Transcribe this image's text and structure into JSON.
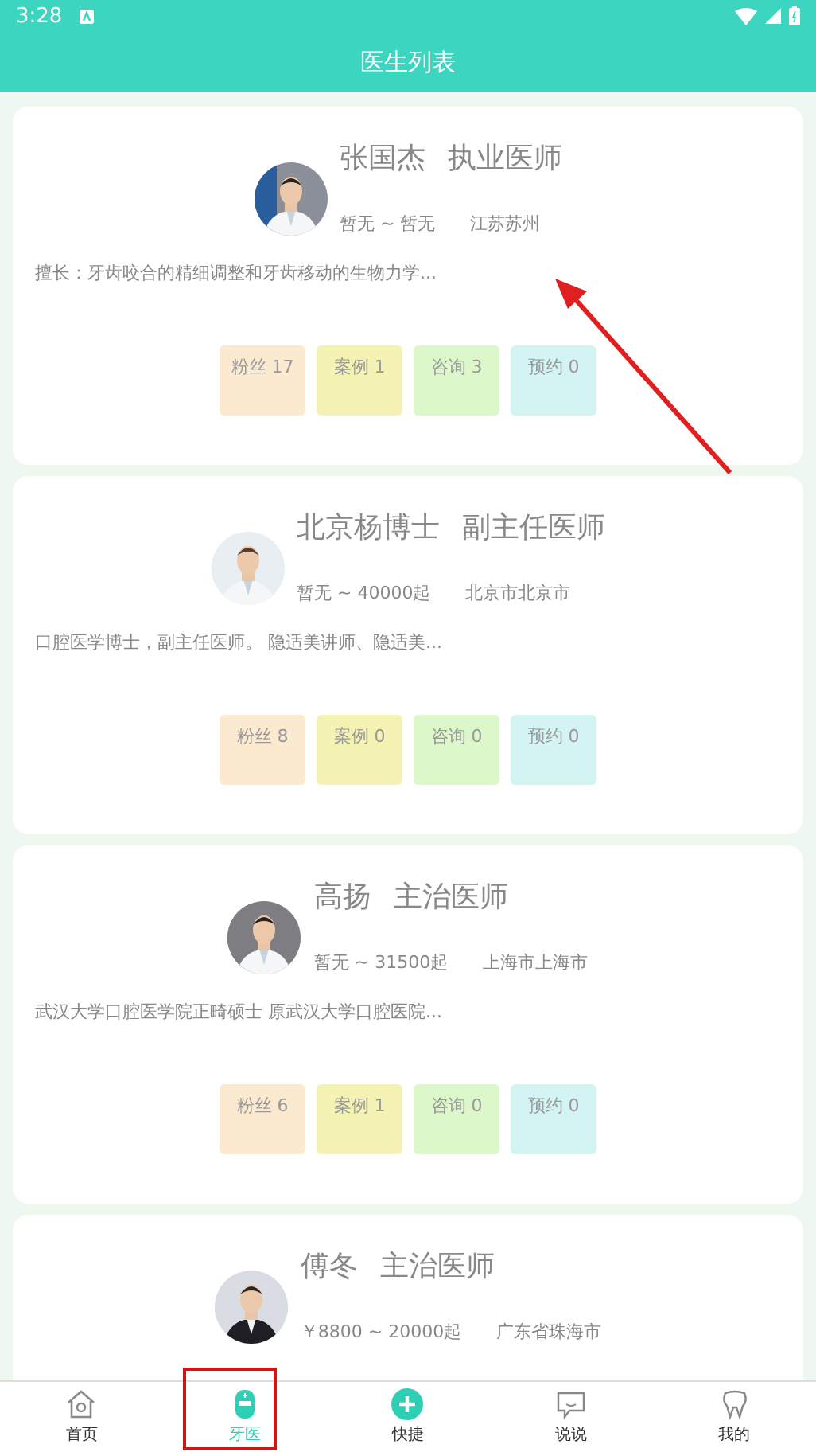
{
  "status_bar": {
    "time": "3:28"
  },
  "header": {
    "title": "医生列表"
  },
  "doctors": [
    {
      "name": "张国杰",
      "title": "执业医师",
      "price": "暂无 ~ 暂无",
      "location": "江苏苏州",
      "description": "擅长：牙齿咬合的精细调整和牙齿移动的生物力学...",
      "stats": [
        {
          "label": "粉丝 17",
          "color": "#fbe9d0"
        },
        {
          "label": "案例 1",
          "color": "#f5f3b4"
        },
        {
          "label": "咨询 3",
          "color": "#dcf7c9"
        },
        {
          "label": "预约 0",
          "color": "#d4f4f4"
        }
      ]
    },
    {
      "name": "北京杨博士",
      "title": "副主任医师",
      "price": "暂无 ~ 40000起",
      "location": "北京市北京市",
      "description": "口腔医学博士，副主任医师。 隐适美讲师、隐适美...",
      "stats": [
        {
          "label": "粉丝 8",
          "color": "#fbe9d0"
        },
        {
          "label": "案例 0",
          "color": "#f5f3b4"
        },
        {
          "label": "咨询 0",
          "color": "#dcf7c9"
        },
        {
          "label": "预约 0",
          "color": "#d4f4f4"
        }
      ]
    },
    {
      "name": "高扬",
      "title": "主治医师",
      "price": "暂无 ~ 31500起",
      "location": "上海市上海市",
      "description": "武汉大学口腔医学院正畸硕士 原武汉大学口腔医院...",
      "stats": [
        {
          "label": "粉丝 6",
          "color": "#fbe9d0"
        },
        {
          "label": "案例 1",
          "color": "#f5f3b4"
        },
        {
          "label": "咨询 0",
          "color": "#dcf7c9"
        },
        {
          "label": "预约 0",
          "color": "#d4f4f4"
        }
      ]
    },
    {
      "name": "傅冬",
      "title": "主治医师",
      "price": "￥8800 ~ 20000起",
      "location": "广东省珠海市"
    }
  ],
  "nav": [
    {
      "label": "首页",
      "kind": "tab",
      "selected": false
    },
    {
      "label": "牙医",
      "kind": "tab",
      "selected": true
    },
    {
      "label": "快捷",
      "kind": "action",
      "selected": false
    },
    {
      "label": "说说",
      "kind": "tab",
      "selected": false
    },
    {
      "label": "我的",
      "kind": "tab",
      "selected": false
    }
  ]
}
